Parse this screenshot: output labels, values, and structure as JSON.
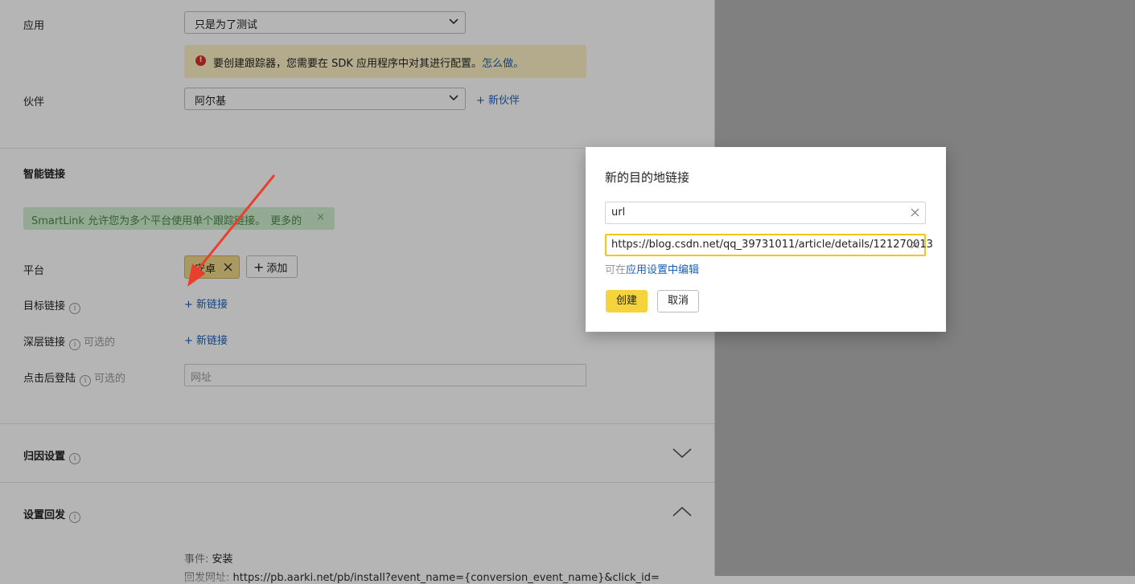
{
  "form": {
    "app_label": "应用",
    "app_value": "只是为了测试",
    "warning_text": "要创建跟踪器，您需要在 SDK 应用程序中对其进行配置。",
    "warning_link": "怎么做。",
    "partner_label": "伙伴",
    "partner_value": "阿尔基",
    "new_partner_link": "+ 新伙伴"
  },
  "smartlink": {
    "section_title": "智能链接",
    "banner_text": "SmartLink 允许您为多个平台使用单个跟踪链接。",
    "banner_more": "更多的",
    "banner_close": "×",
    "platform_label": "平台",
    "platform_chip": "安卓",
    "add_label": "添加",
    "target_link_label": "目标链接",
    "target_new_link": "+ 新链接",
    "deep_link_label": "深层链接",
    "optional_label": "可选的",
    "deep_new_link": "+ 新链接",
    "landing_label": "点击后登陆",
    "landing_optional": "可选的",
    "landing_placeholder": "网址"
  },
  "attribution": {
    "title": "归因设置"
  },
  "postback": {
    "title": "设置回发",
    "event_key": "事件:",
    "event_value": "安装",
    "url_key": "回发网址:",
    "url_value": "https://pb.aarki.net/pb/install?event_name={conversion_event_name}&click_id="
  },
  "modal": {
    "title": "新的目的地链接",
    "name_value": "url",
    "url_value": "https://blog.csdn.net/qq_39731011/article/details/121270013",
    "hint_prefix": "可在",
    "hint_link": "应用设置中编辑",
    "create_label": "创建",
    "cancel_label": "取消"
  },
  "colors": {
    "accent": "#f5d33c",
    "link": "#1a5fb4",
    "warning_bg": "#fdf1c4",
    "success_bg": "#cfeecf",
    "annotation_arrow": "#e8402f"
  }
}
